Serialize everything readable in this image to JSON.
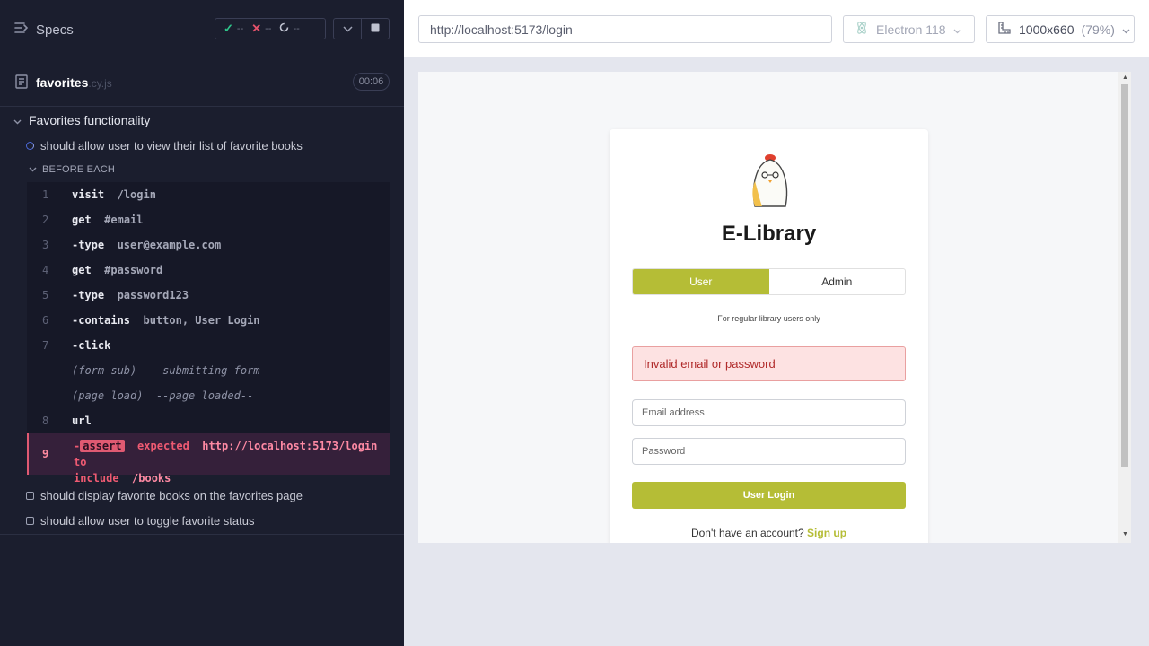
{
  "reporter": {
    "specs_label": "Specs",
    "stats": {
      "passed": "--",
      "failed": "--",
      "pending": "--"
    },
    "spec": {
      "name": "favorites",
      "ext": ".cy.js",
      "duration": "00:06"
    },
    "suite_title": "Favorites functionality",
    "tests": [
      "should allow user to view their list of favorite books",
      "should display favorite books on the favorites page",
      "should allow user to toggle favorite status"
    ],
    "hook_label": "BEFORE EACH",
    "commands": [
      {
        "num": "1",
        "name": "visit",
        "msg": "/login"
      },
      {
        "num": "2",
        "name": "get",
        "msg": "#email"
      },
      {
        "num": "3",
        "name": "-type",
        "msg": "user@example.com"
      },
      {
        "num": "4",
        "name": "get",
        "msg": "#password"
      },
      {
        "num": "5",
        "name": "-type",
        "msg": "password123"
      },
      {
        "num": "6",
        "name": "-contains",
        "msg": "button, User Login"
      },
      {
        "num": "7",
        "name": "-click",
        "msg": ""
      },
      {
        "num": "",
        "name": "(form sub)",
        "msg": "--submitting form--"
      },
      {
        "num": "",
        "name": "(page load)",
        "msg": "--page loaded--"
      },
      {
        "num": "8",
        "name": "url",
        "msg": ""
      }
    ],
    "failed_command": {
      "num": "9",
      "prefix": "-",
      "name": "assert",
      "expected": "expected",
      "url": "http://localhost:5173/login",
      "to": "to",
      "include": "include",
      "target": "/books"
    }
  },
  "browser": {
    "url": "http://localhost:5173/login",
    "browser_name": "Electron 118",
    "viewport": "1000x660",
    "zoom": "(79%)"
  },
  "app": {
    "title": "E-Library",
    "roles": [
      "User",
      "Admin"
    ],
    "active_role": "User",
    "role_desc": "For regular library users only",
    "error": "Invalid email or password",
    "email_placeholder": "Email address",
    "password_placeholder": "Password",
    "login_label": "User Login",
    "signup_text": "Don't have an account?",
    "signup_link": "Sign up",
    "accent": "#b5bd36"
  }
}
